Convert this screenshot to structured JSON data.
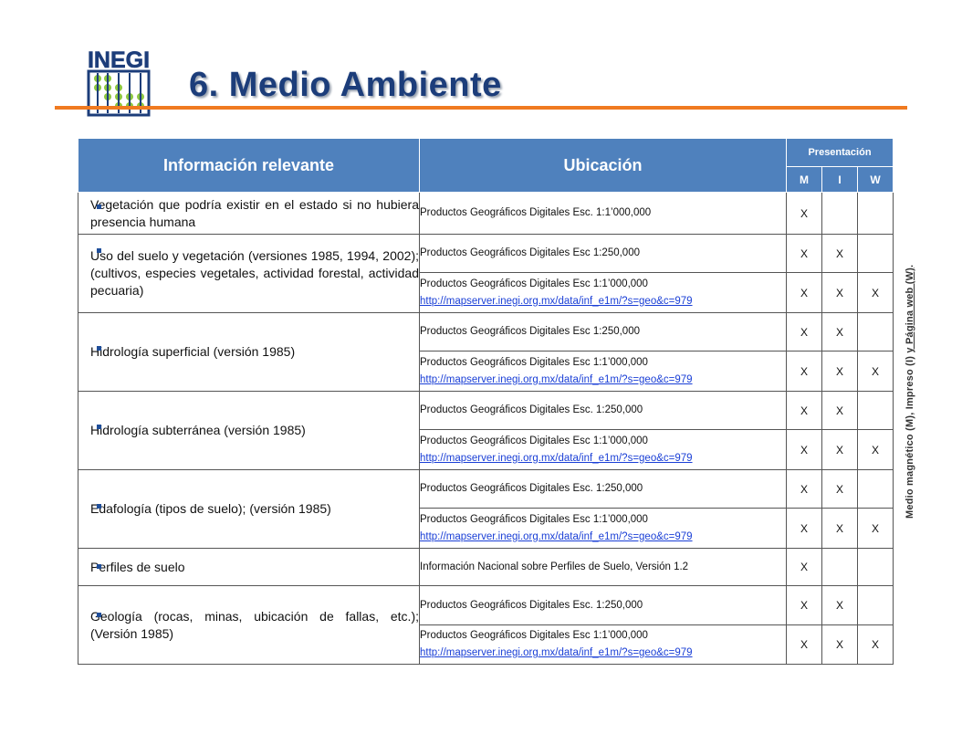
{
  "header": {
    "logo_text": "INEGI",
    "title": "6. Medio Ambiente",
    "accent_color": "#f07a20",
    "title_color": "#1c3d7a"
  },
  "table": {
    "header_color": "#4f81bd",
    "col_info": "Información relevante",
    "col_ubicacion": "Ubicación",
    "col_presentacion": "Presentación",
    "col_m": "M",
    "col_i": "I",
    "col_w": "W",
    "rows": [
      {
        "info": "Vegetación que podría existir en el estado si no hubiera presencia humana",
        "locs": [
          {
            "text": "Productos Geográficos Digitales Esc. 1:1’000,000",
            "m": "X",
            "i": "",
            "w": ""
          }
        ]
      },
      {
        "info": "Uso del suelo y vegetación (versiones 1985, 1994, 2002); (cultivos, especies vegetales, actividad forestal, actividad pecuaria)",
        "locs": [
          {
            "text": "Productos Geográficos Digitales Esc 1:250,000",
            "m": "X",
            "i": "X",
            "w": ""
          },
          {
            "text": "Productos Geográficos Digitales Esc 1:1’000,000",
            "link": "http://mapserver.inegi.org.mx/data/inf_e1m/?s=geo&c=979",
            "m": "X",
            "i": "X",
            "w": "X"
          }
        ]
      },
      {
        "info": "Hidrología  superficial (versión 1985)",
        "locs": [
          {
            "text": "Productos Geográficos Digitales Esc 1:250,000",
            "m": "X",
            "i": "X",
            "w": ""
          },
          {
            "text": "Productos Geográficos Digitales Esc 1:1’000,000",
            "link": "http://mapserver.inegi.org.mx/data/inf_e1m/?s=geo&c=979",
            "m": "X",
            "i": "X",
            "w": "X"
          }
        ]
      },
      {
        "info": "Hidrología subterránea (versión 1985)",
        "locs": [
          {
            "text": "Productos Geográficos Digitales Esc. 1:250,000",
            "m": "X",
            "i": "X",
            "w": ""
          },
          {
            "text": "Productos Geográficos Digitales Esc 1:1’000,000",
            "link": "http://mapserver.inegi.org.mx/data/inf_e1m/?s=geo&c=979",
            "m": "X",
            "i": "X",
            "w": "X"
          }
        ]
      },
      {
        "info": "Edafología (tipos de suelo); (versión 1985)",
        "locs": [
          {
            "text": "Productos Geográficos Digitales Esc. 1:250,000",
            "m": "X",
            "i": "X",
            "w": ""
          },
          {
            "text": "Productos Geográficos Digitales Esc 1:1’000,000",
            "link": "http://mapserver.inegi.org.mx/data/inf_e1m/?s=geo&c=979",
            "m": "X",
            "i": "X",
            "w": "X"
          }
        ]
      },
      {
        "info": "Perfiles de suelo",
        "locs": [
          {
            "text": "Información Nacional sobre Perfiles de Suelo, Versión 1.2",
            "m": "X",
            "i": "",
            "w": ""
          }
        ]
      },
      {
        "info": "Geología (rocas, minas, ubicación de fallas, etc.); (Versión 1985)",
        "locs": [
          {
            "text": "Productos Geográficos Digitales Esc. 1:250,000",
            "m": "X",
            "i": "X",
            "w": ""
          },
          {
            "text": "Productos Geográficos Digitales Esc 1:1’000,000",
            "link": "http://mapserver.inegi.org.mx/data/inf_e1m/?s=geo&c=979",
            "m": "X",
            "i": "X",
            "w": "X"
          }
        ]
      }
    ]
  },
  "sidenote": {
    "prefix": "Medio magnético (M), Impreso (I) ",
    "underlined": "y Página web (W)",
    "suffix": "."
  }
}
